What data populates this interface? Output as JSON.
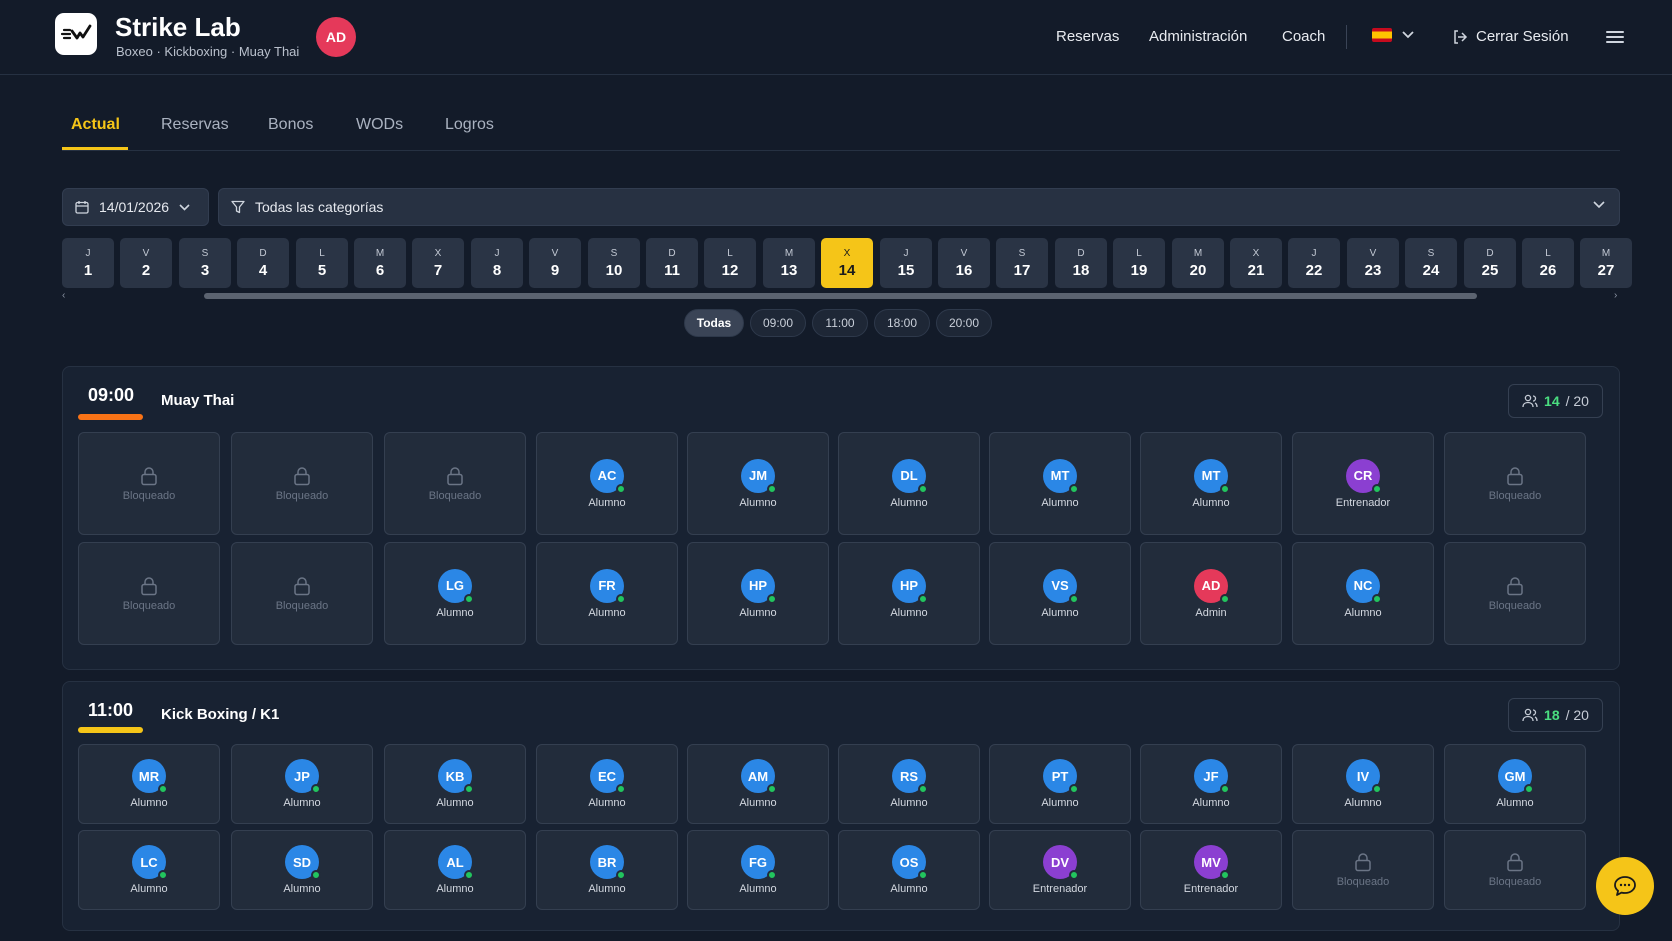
{
  "header": {
    "brand_title": "Strike Lab",
    "brand_subtitle": "Boxeo · Kickboxing · Muay Thai",
    "user_initials": "AD",
    "nav": [
      "Reservas",
      "Administración",
      "Coach"
    ],
    "logout_label": "Cerrar Sesión",
    "language_flag": "es-flag-icon"
  },
  "tabs": [
    {
      "label": "Actual",
      "active": true
    },
    {
      "label": "Reservas",
      "active": false
    },
    {
      "label": "Bonos",
      "active": false
    },
    {
      "label": "WODs",
      "active": false
    },
    {
      "label": "Logros",
      "active": false
    }
  ],
  "filters": {
    "date": "14/01/2026",
    "category": "Todas las categorías"
  },
  "days": [
    {
      "l": "J",
      "n": "1"
    },
    {
      "l": "V",
      "n": "2"
    },
    {
      "l": "S",
      "n": "3"
    },
    {
      "l": "D",
      "n": "4"
    },
    {
      "l": "L",
      "n": "5"
    },
    {
      "l": "M",
      "n": "6"
    },
    {
      "l": "X",
      "n": "7"
    },
    {
      "l": "J",
      "n": "8"
    },
    {
      "l": "V",
      "n": "9"
    },
    {
      "l": "S",
      "n": "10"
    },
    {
      "l": "D",
      "n": "11"
    },
    {
      "l": "L",
      "n": "12"
    },
    {
      "l": "M",
      "n": "13"
    },
    {
      "l": "X",
      "n": "14"
    },
    {
      "l": "J",
      "n": "15"
    },
    {
      "l": "V",
      "n": "16"
    },
    {
      "l": "S",
      "n": "17"
    },
    {
      "l": "D",
      "n": "18"
    },
    {
      "l": "L",
      "n": "19"
    },
    {
      "l": "M",
      "n": "20"
    },
    {
      "l": "X",
      "n": "21"
    },
    {
      "l": "J",
      "n": "22"
    },
    {
      "l": "V",
      "n": "23"
    },
    {
      "l": "S",
      "n": "24"
    },
    {
      "l": "D",
      "n": "25"
    },
    {
      "l": "L",
      "n": "26"
    },
    {
      "l": "M",
      "n": "27"
    }
  ],
  "selected_day": "14",
  "time_filters": [
    "Todas",
    "09:00",
    "11:00",
    "18:00",
    "20:00"
  ],
  "active_time_filter": "Todas",
  "colors": {
    "accent": "#f5c518",
    "bar_0900": "#f97316",
    "bar_1100": "#f5c518",
    "alumno": "#2b87e6",
    "entrenador": "#8b3fd1",
    "admin": "#e5395a",
    "online": "#22c55e"
  },
  "sessions": [
    {
      "time": "09:00",
      "class_name": "Muay Thai",
      "capacity_booked": "14",
      "capacity_total": "/ 20",
      "slots": [
        {
          "type": "locked",
          "label": "Bloqueado"
        },
        {
          "type": "locked",
          "label": "Bloqueado"
        },
        {
          "type": "locked",
          "label": "Bloqueado"
        },
        {
          "type": "user",
          "initials": "AC",
          "role": "Alumno"
        },
        {
          "type": "user",
          "initials": "JM",
          "role": "Alumno"
        },
        {
          "type": "user",
          "initials": "DL",
          "role": "Alumno"
        },
        {
          "type": "user",
          "initials": "MT",
          "role": "Alumno"
        },
        {
          "type": "user",
          "initials": "MT",
          "role": "Alumno"
        },
        {
          "type": "user",
          "initials": "CR",
          "role": "Entrenador"
        },
        {
          "type": "locked",
          "label": "Bloqueado"
        },
        {
          "type": "locked",
          "label": "Bloqueado"
        },
        {
          "type": "locked",
          "label": "Bloqueado"
        },
        {
          "type": "user",
          "initials": "LG",
          "role": "Alumno"
        },
        {
          "type": "user",
          "initials": "FR",
          "role": "Alumno"
        },
        {
          "type": "user",
          "initials": "HP",
          "role": "Alumno"
        },
        {
          "type": "user",
          "initials": "HP",
          "role": "Alumno"
        },
        {
          "type": "user",
          "initials": "VS",
          "role": "Alumno"
        },
        {
          "type": "user",
          "initials": "AD",
          "role": "Admin"
        },
        {
          "type": "user",
          "initials": "NC",
          "role": "Alumno"
        },
        {
          "type": "locked",
          "label": "Bloqueado"
        }
      ]
    },
    {
      "time": "11:00",
      "class_name": "Kick Boxing / K1",
      "capacity_booked": "18",
      "capacity_total": "/ 20",
      "slots": [
        {
          "type": "user",
          "initials": "MR",
          "role": "Alumno"
        },
        {
          "type": "user",
          "initials": "JP",
          "role": "Alumno"
        },
        {
          "type": "user",
          "initials": "KB",
          "role": "Alumno"
        },
        {
          "type": "user",
          "initials": "EC",
          "role": "Alumno"
        },
        {
          "type": "user",
          "initials": "AM",
          "role": "Alumno"
        },
        {
          "type": "user",
          "initials": "RS",
          "role": "Alumno"
        },
        {
          "type": "user",
          "initials": "PT",
          "role": "Alumno"
        },
        {
          "type": "user",
          "initials": "JF",
          "role": "Alumno"
        },
        {
          "type": "user",
          "initials": "IV",
          "role": "Alumno"
        },
        {
          "type": "user",
          "initials": "GM",
          "role": "Alumno"
        },
        {
          "type": "user",
          "initials": "LC",
          "role": "Alumno"
        },
        {
          "type": "user",
          "initials": "SD",
          "role": "Alumno"
        },
        {
          "type": "user",
          "initials": "AL",
          "role": "Alumno"
        },
        {
          "type": "user",
          "initials": "BR",
          "role": "Alumno"
        },
        {
          "type": "user",
          "initials": "FG",
          "role": "Alumno"
        },
        {
          "type": "user",
          "initials": "OS",
          "role": "Alumno"
        },
        {
          "type": "user",
          "initials": "DV",
          "role": "Entrenador"
        },
        {
          "type": "user",
          "initials": "MV",
          "role": "Entrenador"
        },
        {
          "type": "locked",
          "label": "Bloqueado"
        },
        {
          "type": "locked",
          "label": "Bloqueado"
        }
      ]
    }
  ]
}
